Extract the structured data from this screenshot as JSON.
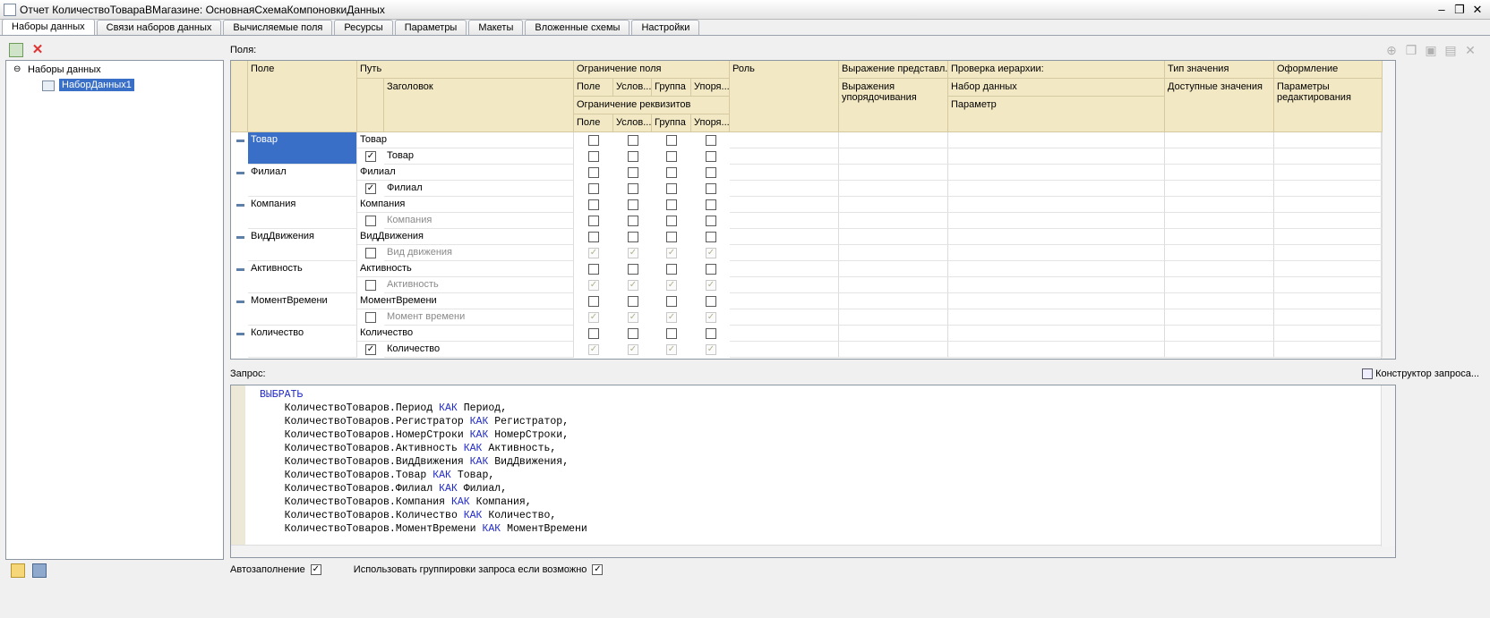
{
  "window": {
    "title": "Отчет КоличествоТовараВМагазине: ОсновнаяСхемаКомпоновкиДанных",
    "minimize": "–",
    "restore": "❐",
    "close": "✕"
  },
  "tabs": [
    "Наборы данных",
    "Связи наборов данных",
    "Вычисляемые поля",
    "Ресурсы",
    "Параметры",
    "Макеты",
    "Вложенные схемы",
    "Настройки"
  ],
  "tree": {
    "root": "Наборы данных",
    "child": "НаборДанных1"
  },
  "fields_label": "Поля:",
  "headers": {
    "pole": "Поле",
    "put": "Путь",
    "zagolovok": "Заголовок",
    "ogr_polya": "Ограничение поля",
    "ogr_rekv": "Ограничение реквизитов",
    "sub": [
      "Поле",
      "Услов...",
      "Группа",
      "Упоря..."
    ],
    "rol": "Роль",
    "vyr_pred": "Выражение представл...",
    "vyr_upor": "Выражения упорядочивания",
    "prov_ier": "Проверка иерархии:",
    "nabor": "Набор данных",
    "parametr": "Параметр",
    "tip": "Тип значения",
    "dostup": "Доступные значения",
    "oform": "Оформление",
    "param_red": "Параметры редактирования"
  },
  "rows": [
    {
      "pole": "Товар",
      "put": "Товар",
      "title": "Товар",
      "checked": true,
      "disabled": false
    },
    {
      "pole": "Филиал",
      "put": "Филиал",
      "title": "Филиал",
      "checked": true,
      "disabled": false
    },
    {
      "pole": "Компания",
      "put": "Компания",
      "title": "Компания",
      "checked": false,
      "disabled": false
    },
    {
      "pole": "ВидДвижения",
      "put": "ВидДвижения",
      "title": "Вид движения",
      "checked": false,
      "disabled": true
    },
    {
      "pole": "Активность",
      "put": "Активность",
      "title": "Активность",
      "checked": false,
      "disabled": true
    },
    {
      "pole": "МоментВремени",
      "put": "МоментВремени",
      "title": "Момент времени",
      "checked": false,
      "disabled": true
    },
    {
      "pole": "Количество",
      "put": "Количество",
      "title": "Количество",
      "checked": true,
      "disabled": true
    }
  ],
  "query_label": "Запрос:",
  "konstruktor": "Конструктор запроса...",
  "query": {
    "select": "ВЫБРАТЬ",
    "kak": "КАК",
    "lines": [
      [
        "КоличествоТоваров.Период",
        "Период,"
      ],
      [
        "КоличествоТоваров.Регистратор",
        "Регистратор,"
      ],
      [
        "КоличествоТоваров.НомерСтроки",
        "НомерСтроки,"
      ],
      [
        "КоличествоТоваров.Активность",
        "Активность,"
      ],
      [
        "КоличествоТоваров.ВидДвижения",
        "ВидДвижения,"
      ],
      [
        "КоличествоТоваров.Товар",
        "Товар,"
      ],
      [
        "КоличествоТоваров.Филиал",
        "Филиал,"
      ],
      [
        "КоличествоТоваров.Компания",
        "Компания,"
      ],
      [
        "КоличествоТоваров.Количество",
        "Количество,"
      ],
      [
        "КоличествоТоваров.МоментВремени",
        "МоментВремени"
      ]
    ]
  },
  "bottom": {
    "autofill": "Автозаполнение",
    "use_groups": "Использовать группировки запроса если возможно"
  },
  "check_mark": "✓"
}
